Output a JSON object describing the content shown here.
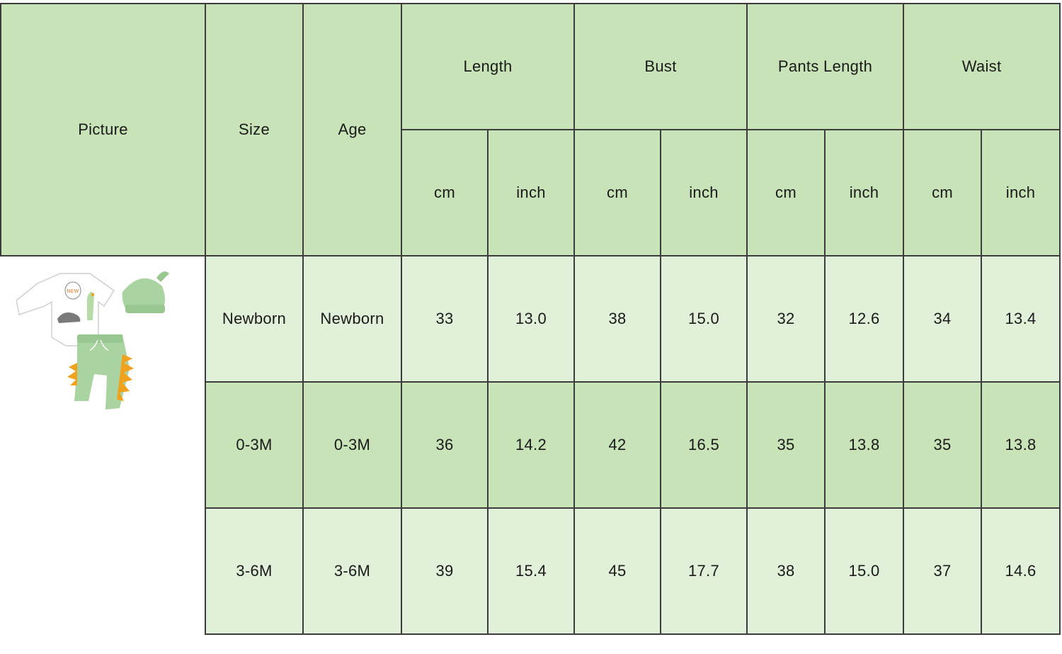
{
  "header": {
    "picture": "Picture",
    "size": "Size",
    "age": "Age",
    "groups": [
      "Length",
      "Bust",
      "Pants Length",
      "Waist"
    ],
    "unit_cm": "cm",
    "unit_inch": "inch"
  },
  "rows": [
    {
      "size": "Newborn",
      "age": "Newborn",
      "length_cm": "33",
      "length_inch": "13.0",
      "bust_cm": "38",
      "bust_inch": "15.0",
      "pants_cm": "32",
      "pants_inch": "12.6",
      "waist_cm": "34",
      "waist_inch": "13.4"
    },
    {
      "size": "0-3M",
      "age": "0-3M",
      "length_cm": "36",
      "length_inch": "14.2",
      "bust_cm": "42",
      "bust_inch": "16.5",
      "pants_cm": "35",
      "pants_inch": "13.8",
      "waist_cm": "35",
      "waist_inch": "13.8"
    },
    {
      "size": "3-6M",
      "age": "3-6M",
      "length_cm": "39",
      "length_inch": "15.4",
      "bust_cm": "45",
      "bust_inch": "17.7",
      "pants_cm": "38",
      "pants_inch": "15.0",
      "waist_cm": "37",
      "waist_inch": "14.6"
    }
  ],
  "colors": {
    "header_green": "#c8e3b8",
    "row_light": "#e1f0d8",
    "row_dark": "#c8e3b8",
    "border": "#3c3c3c",
    "outfit_green": "#a9d4a2",
    "dino_spikes": "#f0a21f"
  },
  "picture": {
    "icon": "baby-outfit-illustration",
    "onesie_text": "NEW"
  }
}
